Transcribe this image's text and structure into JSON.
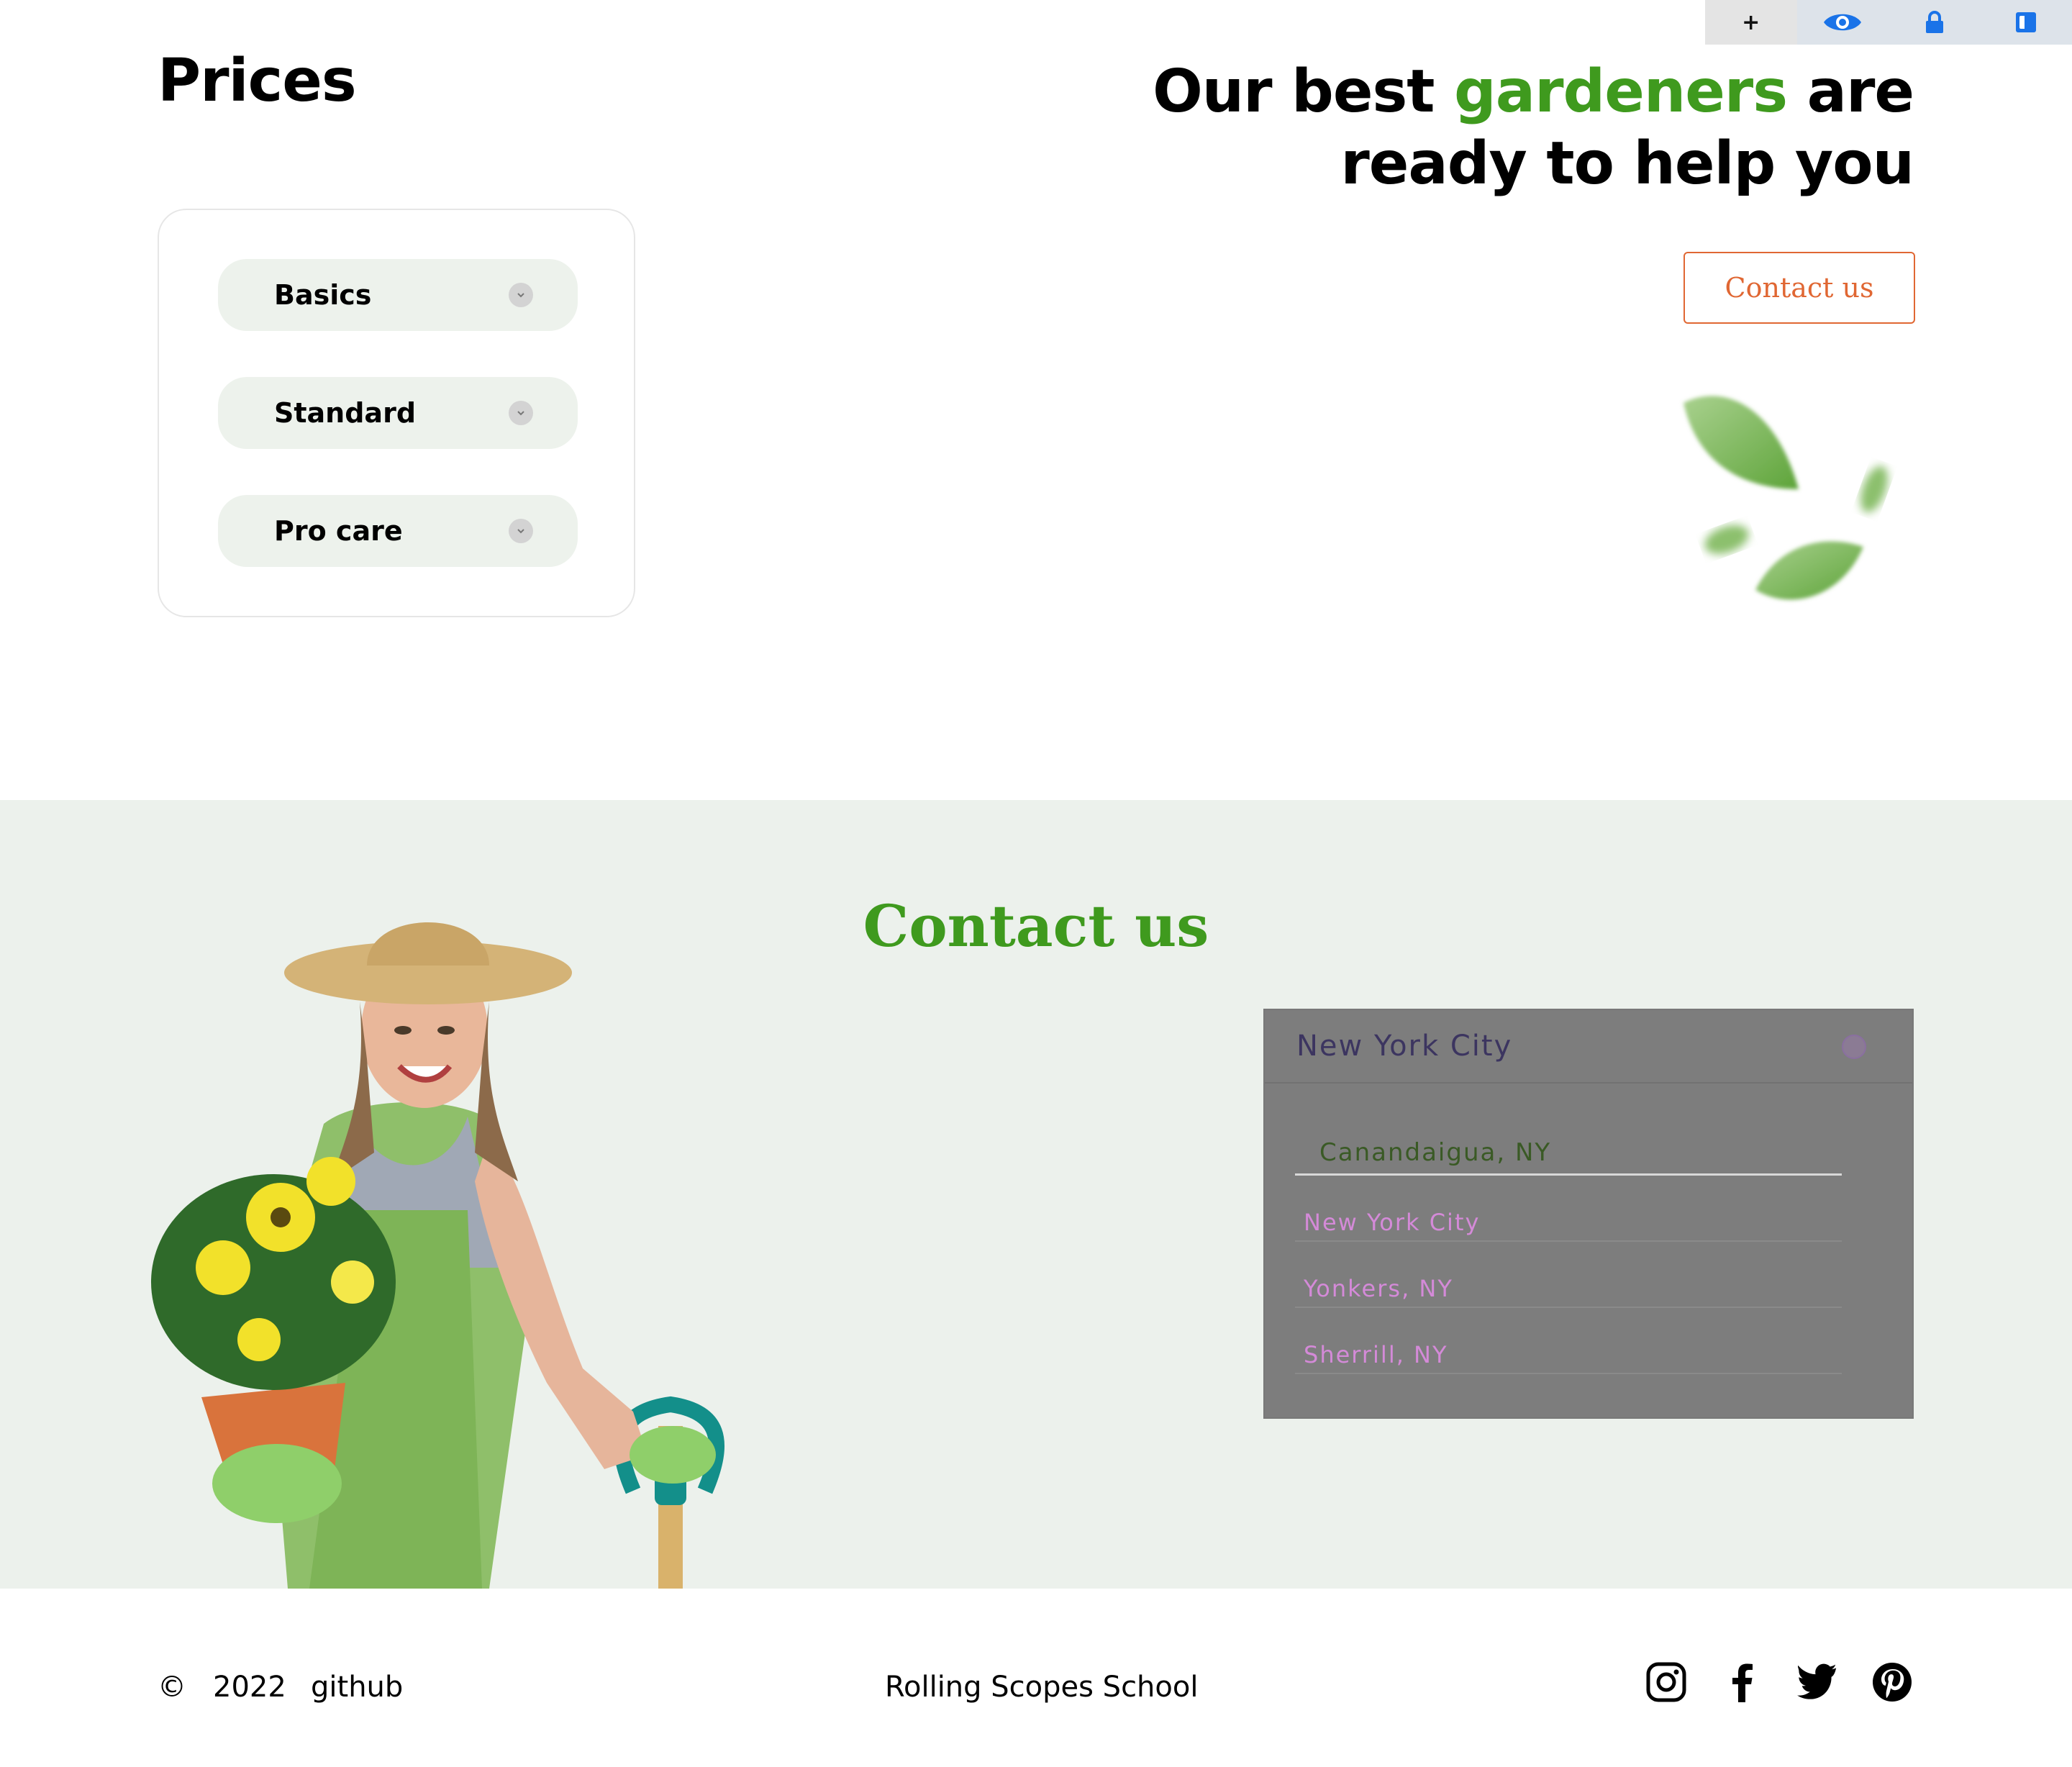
{
  "extension_bar": {
    "plus_label": "+",
    "icons": [
      "eye-icon",
      "lock-icon",
      "window-icon"
    ],
    "accent": "#1a73e8"
  },
  "prices": {
    "title": "Prices",
    "items": [
      {
        "label": "Basics"
      },
      {
        "label": "Standard"
      },
      {
        "label": "Pro care"
      }
    ]
  },
  "hero": {
    "heading_before": "Our best ",
    "heading_accent": "gardeners",
    "heading_after": " are",
    "heading_line2": "ready to help you",
    "contact_button": "Contact us",
    "accent_color": "#3f9a1e",
    "button_color": "#e06733"
  },
  "contact": {
    "title": "Contact us",
    "dropdown": {
      "selected": "New York City",
      "active_option": "Canandaigua, NY",
      "options": [
        "New York City",
        "Yonkers, NY",
        "Sherrill, NY"
      ]
    }
  },
  "footer": {
    "copyright": "©",
    "year": "2022",
    "github": "github",
    "school": "Rolling Scopes School",
    "socials": [
      "instagram-icon",
      "facebook-icon",
      "twitter-icon",
      "pinterest-icon"
    ]
  }
}
